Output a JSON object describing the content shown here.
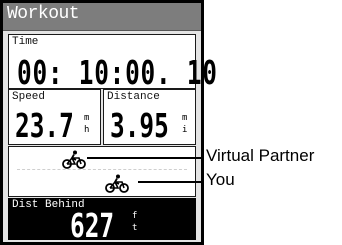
{
  "header": {
    "title": "Workout"
  },
  "fields": {
    "time": {
      "label": "Time",
      "value": "00: 10:00. 10"
    },
    "speed": {
      "label": "Speed",
      "value": "23.7",
      "unit_top": "m",
      "unit_bottom": "h"
    },
    "distance": {
      "label": "Distance",
      "value": "3.95",
      "unit_top": "m",
      "unit_bottom": "i"
    },
    "dist_behind": {
      "label": "Dist Behind",
      "value": "627",
      "unit_top": "f",
      "unit_bottom": "t"
    }
  },
  "callouts": {
    "virtual_partner": "Virtual Partner",
    "you": "You"
  },
  "icons": {
    "virtual_partner": "bicycle-rider-icon",
    "you": "bicycle-rider-icon"
  }
}
